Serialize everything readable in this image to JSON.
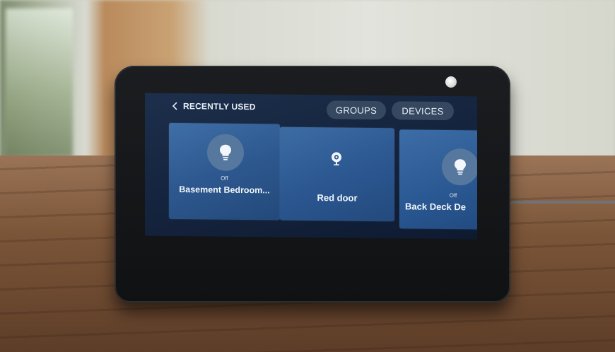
{
  "header": {
    "back_label": "RECENTLY USED",
    "groups_label": "GROUPS",
    "devices_label": "DEVICES"
  },
  "tiles": [
    {
      "icon": "lightbulb-icon",
      "state": "Off",
      "name": "Basement Bedroom..."
    },
    {
      "icon": "camera-icon",
      "state": "",
      "name": "Red door"
    },
    {
      "icon": "lightbulb-icon",
      "state": "Off",
      "name": "Back Deck De"
    }
  ],
  "colors": {
    "screen_bg": "#162640",
    "tile_bg": "#2d588f",
    "pill_bg": "#35485f",
    "icon_circle": "#56789e"
  }
}
